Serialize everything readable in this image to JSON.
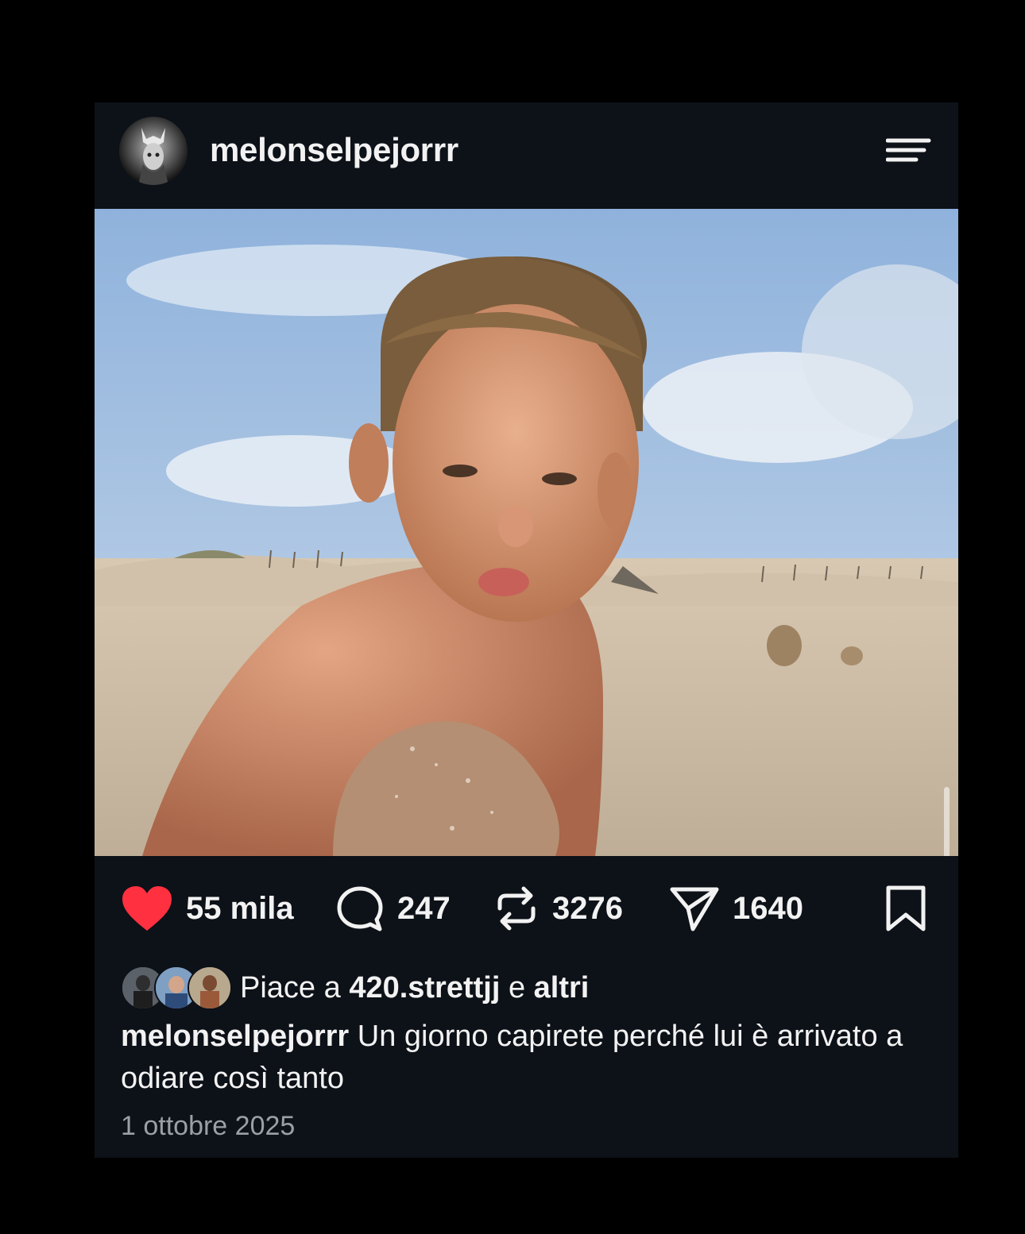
{
  "post": {
    "username": "melonselpejorrr",
    "image_alt": "photo-boy-on-beach"
  },
  "stats": {
    "likes": "55 mila",
    "comments": "247",
    "reposts": "3276",
    "shares": "1640"
  },
  "liked_by": {
    "prefix": "Piace a",
    "user": "420.strettjj",
    "joiner": "e",
    "others": "altri"
  },
  "caption": {
    "username": "melonselpejorrr",
    "text": "Un giorno capirete perché lui è arrivato a odiare così tanto"
  },
  "date": "1 ottobre 2025",
  "colors": {
    "background": "#000000",
    "card": "#0d1118",
    "like_heart": "#ff3040",
    "muted_text": "#9aa0a8"
  },
  "icons": [
    "menu-icon",
    "heart-icon",
    "comment-icon",
    "repost-icon",
    "share-icon",
    "bookmark-icon"
  ]
}
